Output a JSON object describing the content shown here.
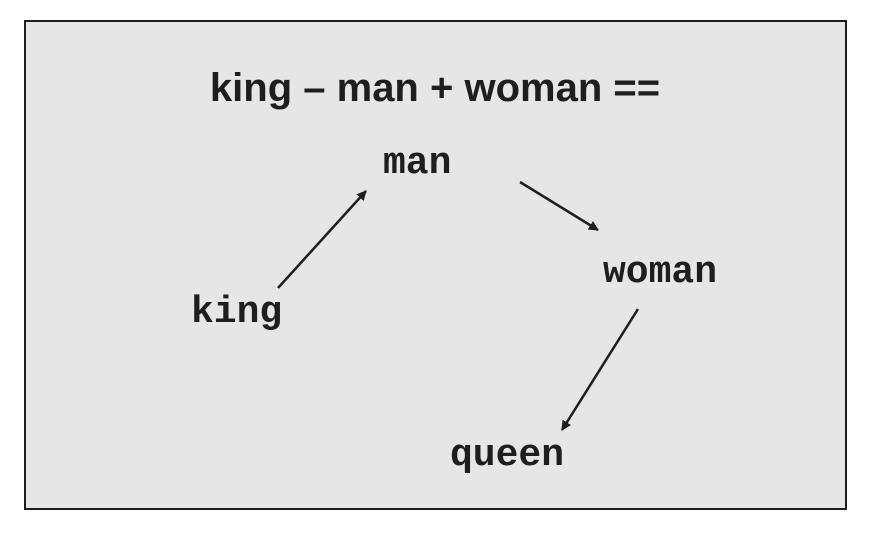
{
  "diagram": {
    "title": "king – man + woman ==",
    "words": {
      "king": "king",
      "man": "man",
      "woman": "woman",
      "queen": "queen"
    },
    "arrows": [
      {
        "from": "king",
        "to": "man"
      },
      {
        "from": "man",
        "to": "woman"
      },
      {
        "from": "woman",
        "to": "queen"
      }
    ]
  }
}
